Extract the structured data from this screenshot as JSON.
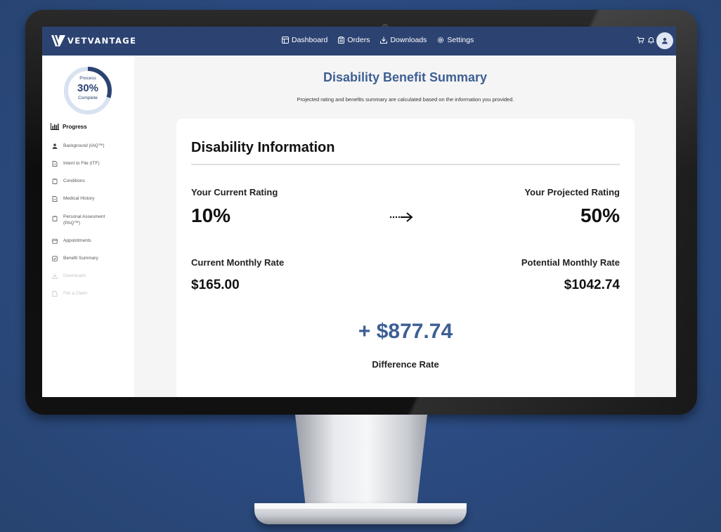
{
  "app": {
    "brand": "VETVANTAGE"
  },
  "nav": {
    "items": [
      {
        "label": "Dashboard",
        "icon": "dashboard-icon"
      },
      {
        "label": "Orders",
        "icon": "clipboard-icon"
      },
      {
        "label": "Downloads",
        "icon": "download-icon"
      },
      {
        "label": "Settings",
        "icon": "gear-icon"
      }
    ]
  },
  "top_icons": [
    "cart-icon",
    "bell-icon",
    "user-avatar"
  ],
  "sidebar": {
    "progress_ring": {
      "top": "Process",
      "percent_label": "30%",
      "bottom": "Complete",
      "value": 0.3
    },
    "heading": "Progress",
    "items": [
      {
        "label": "Background (IAQ™)",
        "icon": "user-icon",
        "enabled": true
      },
      {
        "label": "Intent to File (ITF)",
        "icon": "document-icon",
        "enabled": true
      },
      {
        "label": "Conditions",
        "icon": "clipboard-icon",
        "enabled": true
      },
      {
        "label": "Medical History",
        "icon": "document-icon",
        "enabled": true
      },
      {
        "label": "Personal Assesment (PAQ™)",
        "icon": "clipboard-icon",
        "enabled": true
      },
      {
        "label": "Appointments",
        "icon": "calendar-icon",
        "enabled": true
      },
      {
        "label": "Benefit Summary",
        "icon": "check-icon",
        "enabled": true
      },
      {
        "label": "Downloads",
        "icon": "download-icon",
        "enabled": false
      },
      {
        "label": "File a Claim",
        "icon": "file-icon",
        "enabled": false
      }
    ]
  },
  "main": {
    "title": "Disability Benefit Summary",
    "subtitle": "Projected rating and benefits summary are calculated based on the information you provided.",
    "card": {
      "title": "Disability Information",
      "current_rating_label": "Your Current Rating",
      "current_rating": "10%",
      "projected_rating_label": "Your Projected Rating",
      "projected_rating": "50%",
      "current_rate_label": "Current Monthly Rate",
      "current_rate": "$165.00",
      "potential_rate_label": "Potential Monthly Rate",
      "potential_rate": "$1042.74",
      "difference": "+ $877.74",
      "difference_label": "Difference Rate"
    }
  },
  "colors": {
    "accent": "#3e5f94",
    "topbar": "#2c4372",
    "background": "#2b4a80"
  }
}
